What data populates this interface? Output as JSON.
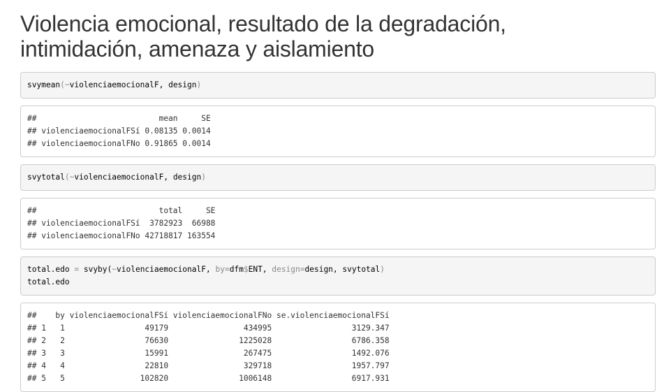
{
  "heading": {
    "line1": "Violencia emocional, resultado de la degradación,",
    "line2": "intimidación, amenaza y aislamiento"
  },
  "chunks": [
    {
      "kind": "code",
      "lines": [
        [
          {
            "t": "svymean",
            "c": "var"
          },
          {
            "t": "(~",
            "c": "op"
          },
          {
            "t": "violenciaemocionalF, design",
            "c": "var"
          },
          {
            "t": ")",
            "c": "op"
          }
        ]
      ]
    },
    {
      "kind": "output",
      "lines": [
        "##                          mean     SE",
        "## violenciaemocionalFSí 0.08135 0.0014",
        "## violenciaemocionalFNo 0.91865 0.0014"
      ]
    },
    {
      "kind": "code",
      "lines": [
        [
          {
            "t": "svytotal",
            "c": "var"
          },
          {
            "t": "(~",
            "c": "op"
          },
          {
            "t": "violenciaemocionalF, design",
            "c": "var"
          },
          {
            "t": ")",
            "c": "op"
          }
        ]
      ]
    },
    {
      "kind": "output",
      "lines": [
        "##                          total     SE",
        "## violenciaemocionalFSí  3782923  66988",
        "## violenciaemocionalFNo 42718817 163554"
      ]
    },
    {
      "kind": "code",
      "lines": [
        [
          {
            "t": "total.edo ",
            "c": "var"
          },
          {
            "t": "=",
            "c": "op"
          },
          {
            "t": " svyby(",
            "c": "var"
          },
          {
            "t": "~",
            "c": "op"
          },
          {
            "t": "violenciaemocionalF, ",
            "c": "var"
          },
          {
            "t": "by=",
            "c": "op"
          },
          {
            "t": "dfm",
            "c": "var"
          },
          {
            "t": "$",
            "c": "op"
          },
          {
            "t": "ENT, ",
            "c": "var"
          },
          {
            "t": "design=",
            "c": "op"
          },
          {
            "t": "design, svytotal",
            "c": "var"
          },
          {
            "t": ")",
            "c": "op"
          }
        ],
        [
          {
            "t": "total.edo",
            "c": "var"
          }
        ]
      ]
    },
    {
      "kind": "output",
      "lines": [
        "##    by violenciaemocionalFSí violenciaemocionalFNo se.violenciaemocionalFSí",
        "## 1   1                 49179                434995                 3129.347",
        "## 2   2                 76630               1225028                 6786.358",
        "## 3   3                 15991                267475                 1492.076",
        "## 4   4                 22810                329718                 1957.797",
        "## 5   5                102820               1006148                 6917.931"
      ]
    }
  ]
}
